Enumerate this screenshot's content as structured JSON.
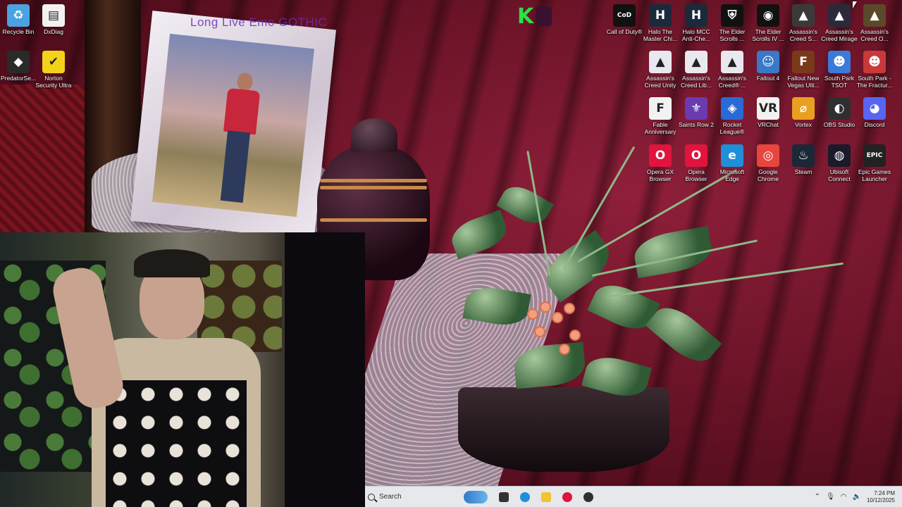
{
  "overlay": {
    "title": "Long Live Emo GOTHIC"
  },
  "corner_logo": {
    "text": "K"
  },
  "desktop_icons": [
    {
      "label": "Recycle Bin",
      "icon": "recycle-bin-icon",
      "glyph": "♻",
      "color": "#4aa3e0"
    },
    {
      "label": "DxDiag",
      "icon": "document-icon",
      "glyph": "▤",
      "color": "#f2f2f2"
    },
    {
      "label": "PredatorSe...",
      "icon": "predator-sense-icon",
      "glyph": "◆",
      "color": "#2a2a2a"
    },
    {
      "label": "Norton Security Ultra",
      "icon": "norton-icon",
      "glyph": "✔",
      "color": "#f2d21a"
    },
    {
      "label": "Call of Duty®",
      "icon": "call-of-duty-icon",
      "glyph": "CoD",
      "color": "#111111"
    },
    {
      "label": "Halo The Master Chi...",
      "icon": "halo-mcc-icon",
      "glyph": "H",
      "color": "#1a2a3a"
    },
    {
      "label": "Halo MCC Anti-Che...",
      "icon": "halo-anticheat-icon",
      "glyph": "H",
      "color": "#1a2a3a"
    },
    {
      "label": "The Elder Scrolls ...",
      "icon": "elder-scrolls-icon",
      "glyph": "⛨",
      "color": "#111111"
    },
    {
      "label": "The Elder Scrolls IV ...",
      "icon": "oblivion-icon",
      "glyph": "◉",
      "color": "#111111"
    },
    {
      "label": "Assassin's Creed S...",
      "icon": "assassins-creed-icon",
      "glyph": "▲",
      "color": "#3a3a3a"
    },
    {
      "label": "Assassin's Creed Mirage",
      "icon": "assassins-creed-mirage-icon",
      "glyph": "▲",
      "color": "#2a2a3a"
    },
    {
      "label": "Assassin's Creed O...",
      "icon": "assassins-creed-origins-icon",
      "glyph": "▲",
      "color": "#5a4a2a"
    },
    {
      "label": "Assassin's Creed Unity",
      "icon": "assassins-creed-unity-icon",
      "glyph": "▲",
      "color": "#e8e8ee"
    },
    {
      "label": "Assassin's Creed Lib...",
      "icon": "assassins-creed-liberation-icon",
      "glyph": "▲",
      "color": "#e8e8ee"
    },
    {
      "label": "Assassin's Creed® ...",
      "icon": "assassins-creed-icon-2",
      "glyph": "▲",
      "color": "#e8e8ee"
    },
    {
      "label": "Fallout 4",
      "icon": "fallout-4-icon",
      "glyph": "☺",
      "color": "#3a78c8"
    },
    {
      "label": "Fallout New Vegas Ulti...",
      "icon": "fallout-new-vegas-icon",
      "glyph": "F",
      "color": "#7a3a1a"
    },
    {
      "label": "South Park TSOT",
      "icon": "south-park-tsot-icon",
      "glyph": "☻",
      "color": "#3a7ad8"
    },
    {
      "label": "South Park - The Fractur...",
      "icon": "south-park-fractured-icon",
      "glyph": "☻",
      "color": "#c83a3a"
    },
    {
      "label": "Fable Anniversary",
      "icon": "fable-icon",
      "glyph": "F",
      "color": "#f2f2f2"
    },
    {
      "label": "Saints Row 2",
      "icon": "saints-row-icon",
      "glyph": "⚜",
      "color": "#6a3ab0"
    },
    {
      "label": "Rocket League®",
      "icon": "rocket-league-icon",
      "glyph": "◈",
      "color": "#2a6ad8"
    },
    {
      "label": "VRChat",
      "icon": "vrchat-icon",
      "glyph": "VR",
      "color": "#f2f2f2"
    },
    {
      "label": "Vortex",
      "icon": "vortex-icon",
      "glyph": "⌀",
      "color": "#e8a020"
    },
    {
      "label": "OBS Studio",
      "icon": "obs-studio-icon",
      "glyph": "◐",
      "color": "#302e31"
    },
    {
      "label": "Discord",
      "icon": "discord-icon",
      "glyph": "◕",
      "color": "#5865f2"
    },
    {
      "label": "Opera GX Browser",
      "icon": "opera-gx-icon",
      "glyph": "O",
      "color": "#e0143c"
    },
    {
      "label": "Opera Browser",
      "icon": "opera-icon",
      "glyph": "O",
      "color": "#e0143c"
    },
    {
      "label": "Microsoft Edge",
      "icon": "edge-icon",
      "glyph": "e",
      "color": "#1e8fd8"
    },
    {
      "label": "Google Chrome",
      "icon": "chrome-icon",
      "glyph": "◎",
      "color": "#e8453c"
    },
    {
      "label": "Steam",
      "icon": "steam-icon",
      "glyph": "♨",
      "color": "#1b2838"
    },
    {
      "label": "Ubisoft Connect",
      "icon": "ubisoft-connect-icon",
      "glyph": "◍",
      "color": "#1a1a2a"
    },
    {
      "label": "Epic Games Launcher",
      "icon": "epic-games-icon",
      "glyph": "EPIC",
      "color": "#222222"
    }
  ],
  "taskbar": {
    "search_placeholder": "Search",
    "apps": [
      {
        "name": "task-view-icon",
        "color": "#333333"
      },
      {
        "name": "edge-taskbar-icon",
        "color": "#1e8fd8"
      },
      {
        "name": "file-explorer-icon",
        "color": "#f2c230"
      },
      {
        "name": "opera-taskbar-icon",
        "color": "#e0143c"
      },
      {
        "name": "obs-taskbar-icon",
        "color": "#302e31"
      }
    ],
    "time": "7:24 PM",
    "date": "10/12/2025"
  }
}
